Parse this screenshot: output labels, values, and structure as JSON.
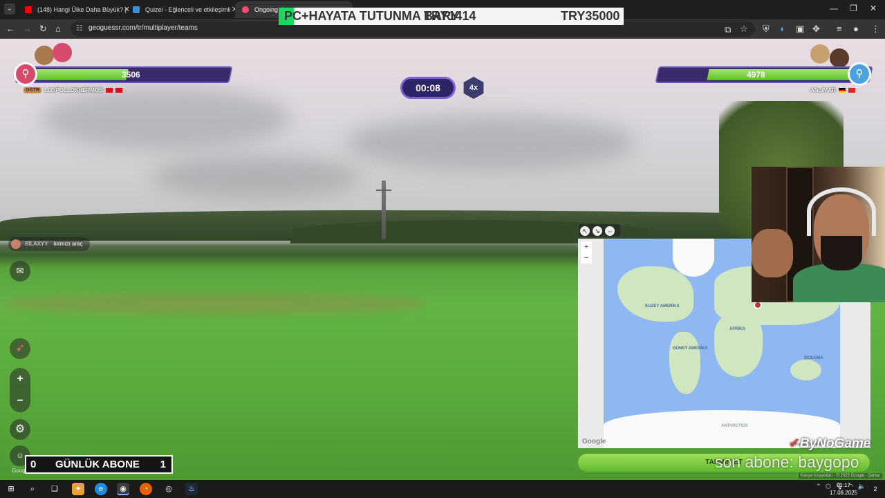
{
  "browser": {
    "tabs": [
      {
        "label": "(148) Hangi Ülke Daha Büyük? |",
        "favicon_color": "#ff0000",
        "active": false
      },
      {
        "label": "Quizei - Eğlenceli ve etkileşimli",
        "favicon_color": "#3c8dde",
        "active": false
      },
      {
        "label": "Ongoing d",
        "favicon_color": "#ff4d6d",
        "active": true
      }
    ],
    "tab_close_glyph": "✕",
    "url": "geoguessr.com/tr/multiplayer/teams"
  },
  "overlay_banner": {
    "left_text": "PC+HAYATA TUTUNMA BARY",
    "mid_text": "TRY1414",
    "right_text": "TRY35000"
  },
  "game": {
    "left_team": {
      "score": "3506",
      "fill": 0.52,
      "tag": "GGTR",
      "name": "LOSPOLLOSHERMOS",
      "color": "#d64b6c"
    },
    "right_team": {
      "score": "4978",
      "fill": 0.82,
      "name": "ANo/MAR",
      "color": "#4aa3e0"
    },
    "timer": "00:08",
    "multiplier": "4x",
    "chat": {
      "user": "BİLAXYY",
      "message": "kırmızı araç"
    },
    "guess_button": "TAHMİN ET",
    "map_labels": {
      "north_america": "KUZEY AMERİKA",
      "south_america": "GÜNEY AMERİKA",
      "africa": "AFRİKA",
      "oceania": "OCEANIA",
      "antarctica": "ANTARCTICA"
    },
    "map_google": "Google",
    "map_credit": "Klavye kısayolları",
    "google_watermark": "Google",
    "keyboard_shortcuts": "Klavye kısayolları · © 2025 Google · Şartlar"
  },
  "stream": {
    "abone_left": "0",
    "abone_label": "GÜNLÜK ABONE",
    "abone_right": "1",
    "brand": "ByNoGame",
    "son_abone": "son abone: baygopo"
  },
  "taskbar": {
    "time": "01:17",
    "date": "17.08.2025",
    "notifications": "2"
  }
}
